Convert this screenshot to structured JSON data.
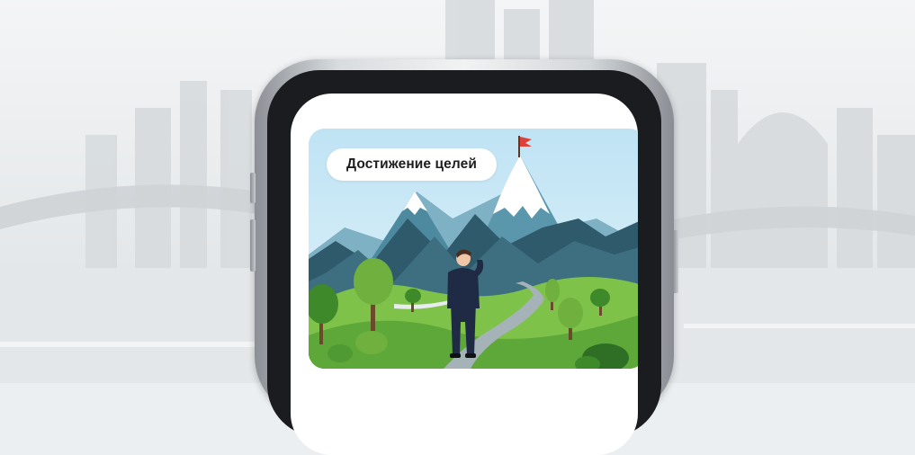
{
  "card": {
    "bubble_text": "Достижение целей"
  },
  "colors": {
    "sky": "#cfe9f5",
    "mountain_dark": "#2e5a6b",
    "mountain_mid": "#4d8aa0",
    "snow": "#ffffff",
    "grass_light": "#7fc24a",
    "grass_mid": "#5ea83a",
    "flag": "#e0403a",
    "suit": "#1f2b44"
  },
  "icons": {
    "flag": "flag-icon"
  }
}
